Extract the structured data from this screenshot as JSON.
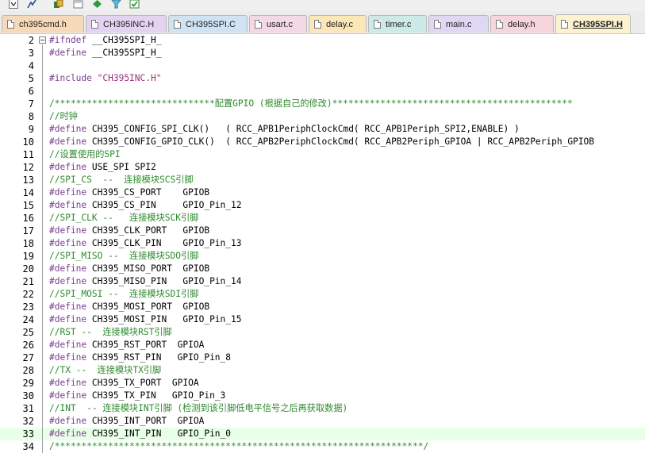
{
  "toolbar": {
    "icons": [
      "dropdown-icon",
      "pin-icon",
      "copy-icon",
      "window-icon",
      "diamond-icon",
      "filter-icon",
      "checklist-icon"
    ]
  },
  "tabs": [
    {
      "label": "ch395cmd.h",
      "active": false,
      "color": "#f6d9b8"
    },
    {
      "label": "CH395INC.H",
      "active": false,
      "color": "#e3d2f0"
    },
    {
      "label": "CH395SPI.C",
      "active": false,
      "color": "#cfe3f3"
    },
    {
      "label": "usart.c",
      "active": false,
      "color": "#f4d8e6"
    },
    {
      "label": "delay.c",
      "active": false,
      "color": "#fbe7b7"
    },
    {
      "label": "timer.c",
      "active": false,
      "color": "#cdeae8"
    },
    {
      "label": "main.c",
      "active": false,
      "color": "#dfd8f2"
    },
    {
      "label": "delay.h",
      "active": false,
      "color": "#f6d6dc"
    },
    {
      "label": "CH395SPI.H",
      "active": true,
      "color": "#fdf2cf"
    }
  ],
  "editor": {
    "current_line": 33,
    "lines": [
      {
        "num": "2",
        "fold": true,
        "segs": [
          {
            "t": "pp",
            "s": "#ifndef"
          },
          {
            "t": "txt",
            "s": " __CH395SPI_H_"
          }
        ]
      },
      {
        "num": "3",
        "segs": [
          {
            "t": "pp",
            "s": "#define"
          },
          {
            "t": "txt",
            "s": " __CH395SPI_H_"
          }
        ]
      },
      {
        "num": "4",
        "segs": []
      },
      {
        "num": "5",
        "segs": [
          {
            "t": "pp",
            "s": "#include"
          },
          {
            "t": "txt",
            "s": " "
          },
          {
            "t": "str",
            "s": "\"CH395INC.H\""
          }
        ]
      },
      {
        "num": "6",
        "segs": []
      },
      {
        "num": "7",
        "segs": [
          {
            "t": "com",
            "s": "/******************************配置GPIO (根据自己的修改)*********************************************"
          }
        ]
      },
      {
        "num": "8",
        "segs": [
          {
            "t": "com",
            "s": "//时钟"
          }
        ]
      },
      {
        "num": "9",
        "segs": [
          {
            "t": "pp",
            "s": "#define"
          },
          {
            "t": "txt",
            "s": " CH395_CONFIG_SPI_CLK()   ( RCC_APB1PeriphClockCmd( RCC_APB1Periph_SPI2,ENABLE) )"
          }
        ]
      },
      {
        "num": "10",
        "segs": [
          {
            "t": "pp",
            "s": "#define"
          },
          {
            "t": "txt",
            "s": " CH395_CONFIG_GPIO_CLK()  ( RCC_APB2PeriphClockCmd( RCC_APB2Periph_GPIOA | RCC_APB2Periph_GPIOB"
          }
        ]
      },
      {
        "num": "11",
        "segs": [
          {
            "t": "com",
            "s": "//设置使用的SPI"
          }
        ]
      },
      {
        "num": "12",
        "segs": [
          {
            "t": "pp",
            "s": "#define"
          },
          {
            "t": "txt",
            "s": " USE_SPI SPI2"
          }
        ]
      },
      {
        "num": "13",
        "segs": [
          {
            "t": "com",
            "s": "//SPI_CS  --  连接模块SCS引脚"
          }
        ]
      },
      {
        "num": "14",
        "segs": [
          {
            "t": "pp",
            "s": "#define"
          },
          {
            "t": "txt",
            "s": " CH395_CS_PORT    GPIOB"
          }
        ]
      },
      {
        "num": "15",
        "segs": [
          {
            "t": "pp",
            "s": "#define"
          },
          {
            "t": "txt",
            "s": " CH395_CS_PIN     GPIO_Pin_12"
          }
        ]
      },
      {
        "num": "16",
        "segs": [
          {
            "t": "com",
            "s": "//SPI_CLK --   连接模块SCK引脚"
          }
        ]
      },
      {
        "num": "17",
        "segs": [
          {
            "t": "pp",
            "s": "#define"
          },
          {
            "t": "txt",
            "s": " CH395_CLK_PORT   GPIOB"
          }
        ]
      },
      {
        "num": "18",
        "segs": [
          {
            "t": "pp",
            "s": "#define"
          },
          {
            "t": "txt",
            "s": " CH395_CLK_PIN    GPIO_Pin_13"
          }
        ]
      },
      {
        "num": "19",
        "segs": [
          {
            "t": "com",
            "s": "//SPI_MISO --  连接模块SDO引脚"
          }
        ]
      },
      {
        "num": "20",
        "segs": [
          {
            "t": "pp",
            "s": "#define"
          },
          {
            "t": "txt",
            "s": " CH395_MISO_PORT  GPIOB"
          }
        ]
      },
      {
        "num": "21",
        "segs": [
          {
            "t": "pp",
            "s": "#define"
          },
          {
            "t": "txt",
            "s": " CH395_MISO_PIN   GPIO_Pin_14"
          }
        ]
      },
      {
        "num": "22",
        "segs": [
          {
            "t": "com",
            "s": "//SPI_MOSI --  连接模块SDI引脚"
          }
        ]
      },
      {
        "num": "23",
        "segs": [
          {
            "t": "pp",
            "s": "#define"
          },
          {
            "t": "txt",
            "s": " CH395_MOSI_PORT  GPIOB"
          }
        ]
      },
      {
        "num": "24",
        "segs": [
          {
            "t": "pp",
            "s": "#define"
          },
          {
            "t": "txt",
            "s": " CH395_MOSI_PIN   GPIO_Pin_15"
          }
        ]
      },
      {
        "num": "25",
        "segs": [
          {
            "t": "com",
            "s": "//RST --  连接模块RST引脚"
          }
        ]
      },
      {
        "num": "26",
        "segs": [
          {
            "t": "pp",
            "s": "#define"
          },
          {
            "t": "txt",
            "s": " CH395_RST_PORT  GPIOA"
          }
        ]
      },
      {
        "num": "27",
        "segs": [
          {
            "t": "pp",
            "s": "#define"
          },
          {
            "t": "txt",
            "s": " CH395_RST_PIN   GPIO_Pin_8"
          }
        ]
      },
      {
        "num": "28",
        "segs": [
          {
            "t": "com",
            "s": "//TX --  连接模块TX引脚"
          }
        ]
      },
      {
        "num": "29",
        "segs": [
          {
            "t": "pp",
            "s": "#define"
          },
          {
            "t": "txt",
            "s": " CH395_TX_PORT  GPIOA"
          }
        ]
      },
      {
        "num": "30",
        "segs": [
          {
            "t": "pp",
            "s": "#define"
          },
          {
            "t": "txt",
            "s": " CH395_TX_PIN   GPIO_Pin_3"
          }
        ]
      },
      {
        "num": "31",
        "segs": [
          {
            "t": "com",
            "s": "//INT  -- 连接模块INT引脚 (检测到该引脚低电平信号之后再获取数据)"
          }
        ]
      },
      {
        "num": "32",
        "segs": [
          {
            "t": "pp",
            "s": "#define"
          },
          {
            "t": "txt",
            "s": " CH395_INT_PORT  GPIOA"
          }
        ]
      },
      {
        "num": "33",
        "segs": [
          {
            "t": "pp",
            "s": "#define"
          },
          {
            "t": "txt",
            "s": " CH395_INT_PIN   GPIO_Pin_0"
          }
        ]
      },
      {
        "num": "34",
        "segs": [
          {
            "t": "com",
            "s": "/*********************************************************************/"
          }
        ]
      }
    ]
  }
}
